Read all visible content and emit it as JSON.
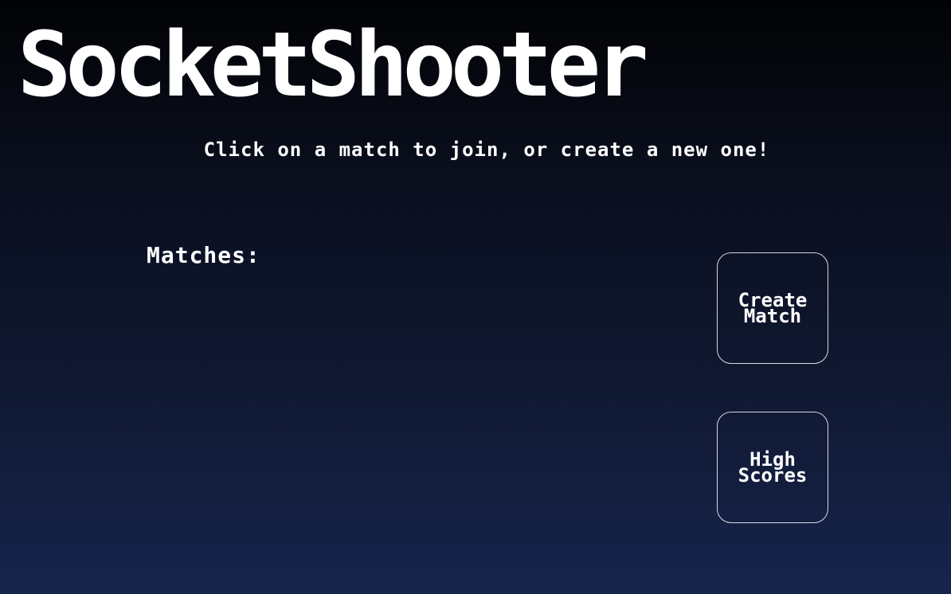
{
  "title": "SocketShooter",
  "subtitle": "Click on a match to join, or create a new one!",
  "matches_label": "Matches:",
  "matches": [],
  "buttons": {
    "create_match": [
      "Create",
      "Match"
    ],
    "high_scores": [
      "High",
      "Scores"
    ]
  },
  "colors": {
    "text": "#ffffff",
    "button_border": "#d6d9e3",
    "background_top": "#020305",
    "background_bottom": "#16244d"
  }
}
